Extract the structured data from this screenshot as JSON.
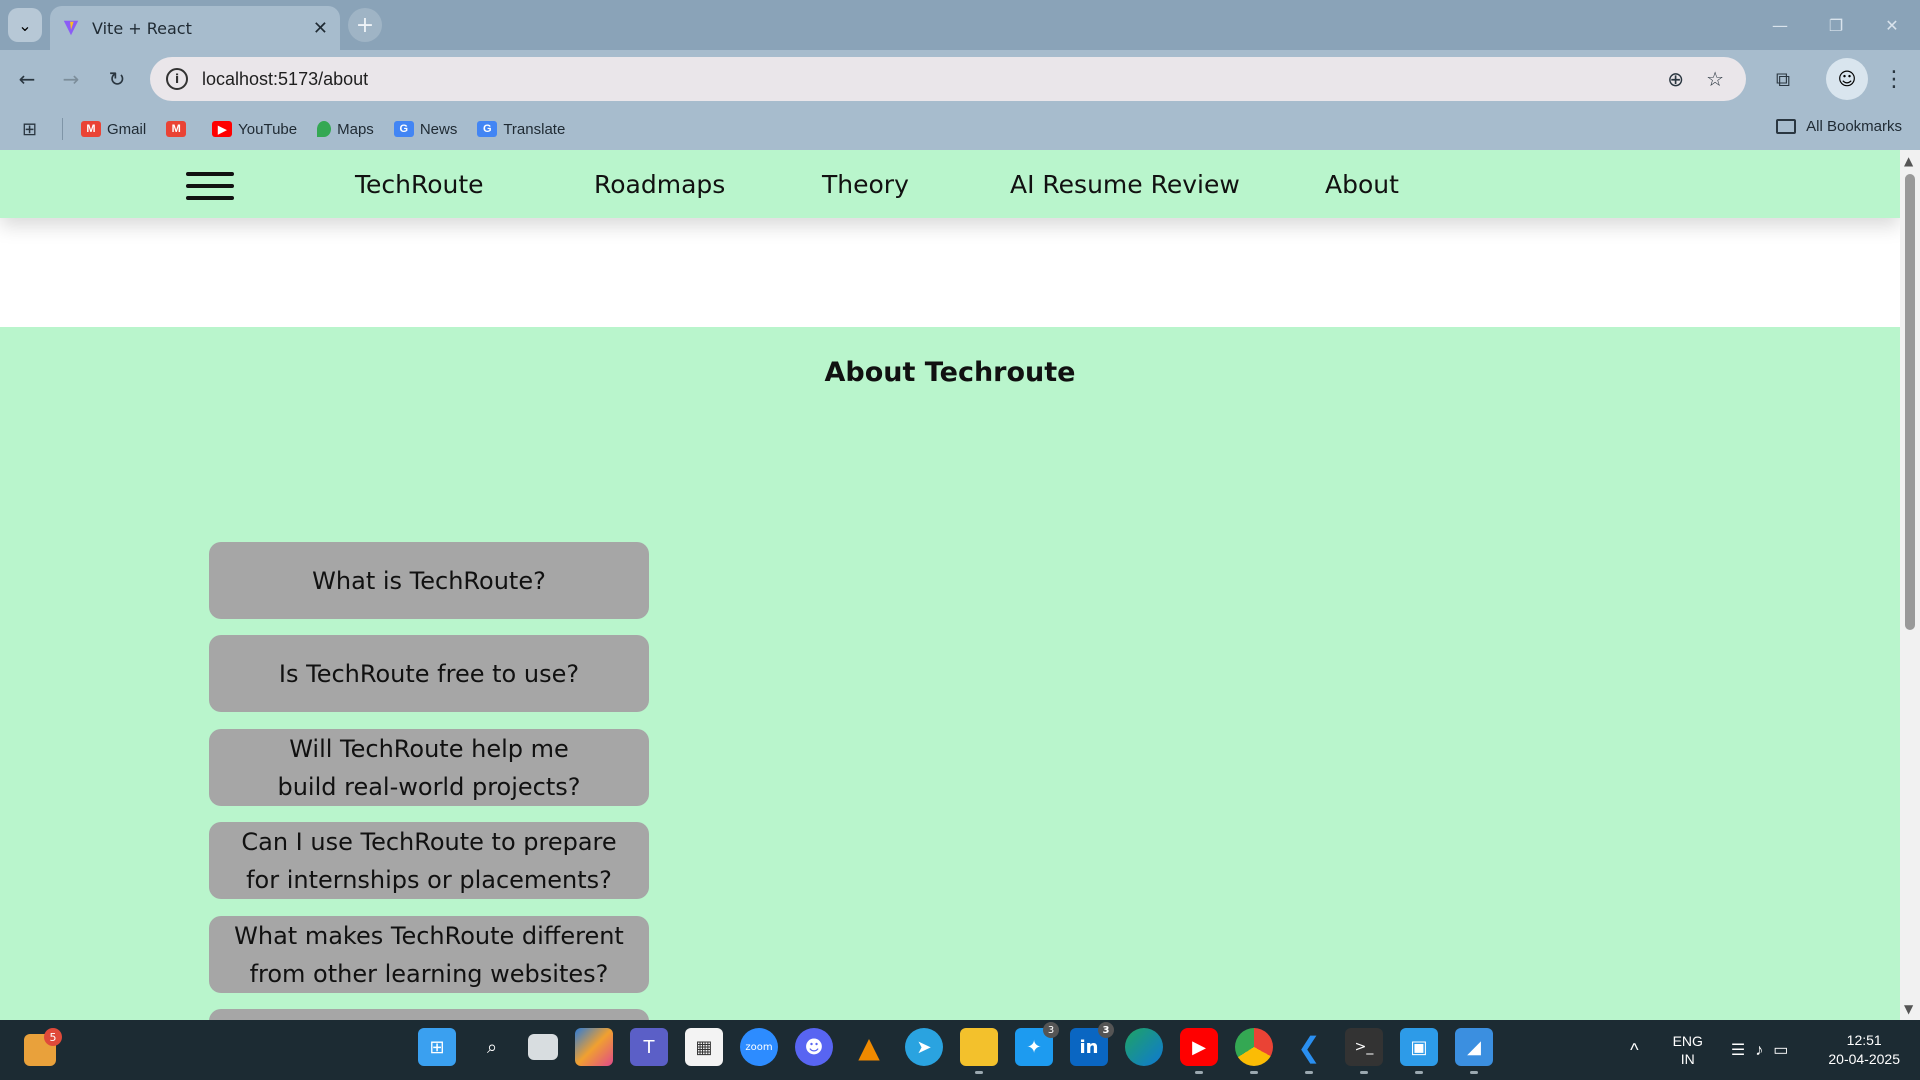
{
  "browser": {
    "tab_title": "Vite + React",
    "url": "localhost:5173/about",
    "bookmarks": [
      {
        "label": "Gmail",
        "color": "#ea4335"
      },
      {
        "label": "",
        "color": "#ea4335"
      },
      {
        "label": "YouTube",
        "color": "#ff0000"
      },
      {
        "label": "Maps",
        "color": "#34a853"
      },
      {
        "label": "News",
        "color": "#4285f4"
      },
      {
        "label": "Translate",
        "color": "#4285f4"
      }
    ],
    "all_bookmarks": "All Bookmarks"
  },
  "navbar": {
    "brand": "TechRoute",
    "links": [
      "Roadmaps",
      "Theory",
      "AI Resume Review",
      "About"
    ]
  },
  "about": {
    "title": "About Techroute",
    "faqs": [
      "What is TechRoute?",
      "Is TechRoute free to use?",
      "Will TechRoute help me\nbuild real-world projects?",
      "Can I use TechRoute to prepare\nfor internships or placements?",
      "What makes TechRoute different\nfrom other learning websites?"
    ]
  },
  "taskbar": {
    "weather_badge": "5",
    "twitter_badge": "3",
    "linkedin_badge": "3",
    "lang_top": "ENG",
    "lang_bottom": "IN",
    "time": "12:51",
    "date": "20-04-2025"
  },
  "colors": {
    "page_green": "#b9f5cc",
    "faq_gray": "#a6a6a6",
    "chrome_blue": "#a7bccd"
  }
}
